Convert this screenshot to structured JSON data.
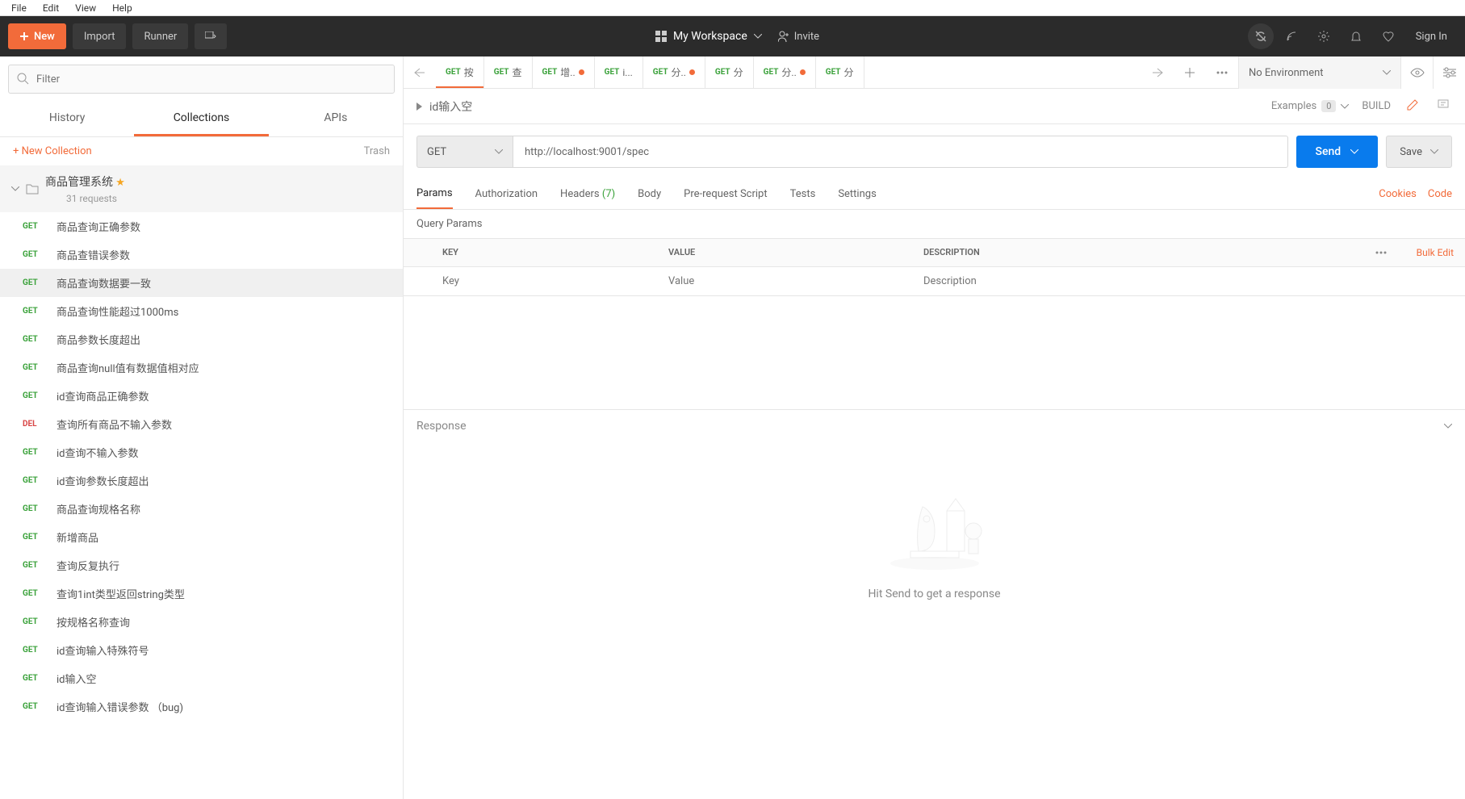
{
  "menubar": [
    "File",
    "Edit",
    "View",
    "Help"
  ],
  "topbar": {
    "new": "New",
    "import": "Import",
    "runner": "Runner",
    "workspace": "My Workspace",
    "invite": "Invite",
    "signin": "Sign In"
  },
  "sidebar": {
    "filter_placeholder": "Filter",
    "tabs": {
      "history": "History",
      "collections": "Collections",
      "apis": "APIs"
    },
    "new_collection": "+  New Collection",
    "trash": "Trash",
    "collection": {
      "name": "商品管理系统",
      "count": "31 requests"
    },
    "requests": [
      {
        "m": "GET",
        "n": "商品查询正确参数"
      },
      {
        "m": "GET",
        "n": "商品查错误参数"
      },
      {
        "m": "GET",
        "n": "商品查询数据要一致",
        "sel": true
      },
      {
        "m": "GET",
        "n": "商品查询性能超过1000ms"
      },
      {
        "m": "GET",
        "n": "商品参数长度超出"
      },
      {
        "m": "GET",
        "n": "商品查询null值有数据值相对应"
      },
      {
        "m": "GET",
        "n": "id查询商品正确参数"
      },
      {
        "m": "DEL",
        "n": "查询所有商品不输入参数"
      },
      {
        "m": "GET",
        "n": "id查询不输入参数"
      },
      {
        "m": "GET",
        "n": "id查询参数长度超出"
      },
      {
        "m": "GET",
        "n": "商品查询规格名称"
      },
      {
        "m": "GET",
        "n": "新增商品"
      },
      {
        "m": "GET",
        "n": "查询反复执行"
      },
      {
        "m": "GET",
        "n": "查询1int类型返回string类型"
      },
      {
        "m": "GET",
        "n": "按规格名称查询"
      },
      {
        "m": "GET",
        "n": "id查询输入特殊符号"
      },
      {
        "m": "GET",
        "n": "id输入空"
      },
      {
        "m": "GET",
        "n": "id查询输入错误参数 （bug)"
      }
    ]
  },
  "tabs": [
    {
      "m": "GET",
      "t": "按",
      "dot": false,
      "active": true
    },
    {
      "m": "GET",
      "t": "查",
      "dot": false
    },
    {
      "m": "GET",
      "t": "增..",
      "dot": true
    },
    {
      "m": "GET",
      "t": "i...",
      "dot": false
    },
    {
      "m": "GET",
      "t": "分..",
      "dot": true
    },
    {
      "m": "GET",
      "t": "分",
      "dot": false
    },
    {
      "m": "GET",
      "t": "分..",
      "dot": true
    },
    {
      "m": "GET",
      "t": "分",
      "dot": false
    }
  ],
  "env": {
    "label": "No Environment"
  },
  "breadcrumb": {
    "title": "id输入空",
    "examples": "Examples",
    "examples_count": "0",
    "build": "BUILD"
  },
  "request": {
    "method": "GET",
    "url": "http://localhost:9001/spec",
    "send": "Send",
    "save": "Save",
    "tabs": {
      "params": "Params",
      "auth": "Authorization",
      "headers": "Headers",
      "headers_count": "(7)",
      "body": "Body",
      "prereq": "Pre-request Script",
      "tests": "Tests",
      "settings": "Settings"
    },
    "cookies": "Cookies",
    "code": "Code",
    "query_label": "Query Params",
    "cols": {
      "key": "KEY",
      "value": "VALUE",
      "desc": "DESCRIPTION"
    },
    "bulk": "Bulk Edit",
    "ph": {
      "key": "Key",
      "value": "Value",
      "desc": "Description"
    }
  },
  "response": {
    "label": "Response",
    "msg": "Hit Send to get a response"
  }
}
